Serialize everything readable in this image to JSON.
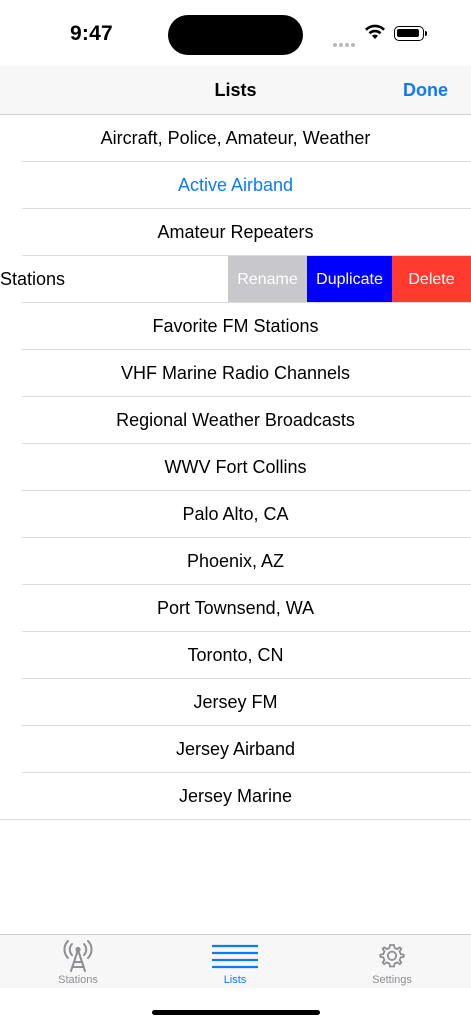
{
  "status_bar": {
    "time": "9:47"
  },
  "nav": {
    "title": "Lists",
    "done_label": "Done"
  },
  "rows": [
    "Aircraft, Police, Amateur, Weather",
    "Active Airband",
    "Amateur Repeaters",
    "Stations",
    "Favorite FM Stations",
    "VHF Marine Radio Channels",
    "Regional Weather Broadcasts",
    "WWV Fort Collins",
    "Palo Alto, CA",
    "Phoenix, AZ",
    "Port Townsend, WA",
    "Toronto, CN",
    "Jersey FM",
    "Jersey Airband",
    "Jersey Marine"
  ],
  "swipe_actions": {
    "rename": "Rename",
    "duplicate": "Duplicate",
    "delete": "Delete"
  },
  "tabs": [
    {
      "label": "Stations",
      "icon": "radio-tower-icon"
    },
    {
      "label": "Lists",
      "icon": "list-lines-icon"
    },
    {
      "label": "Settings",
      "icon": "gear-icon"
    }
  ],
  "colors": {
    "accent": "#0a7aff",
    "rename_bg": "#c7c7cc",
    "duplicate_bg": "#0000ff",
    "delete_bg": "#ff3b30"
  }
}
